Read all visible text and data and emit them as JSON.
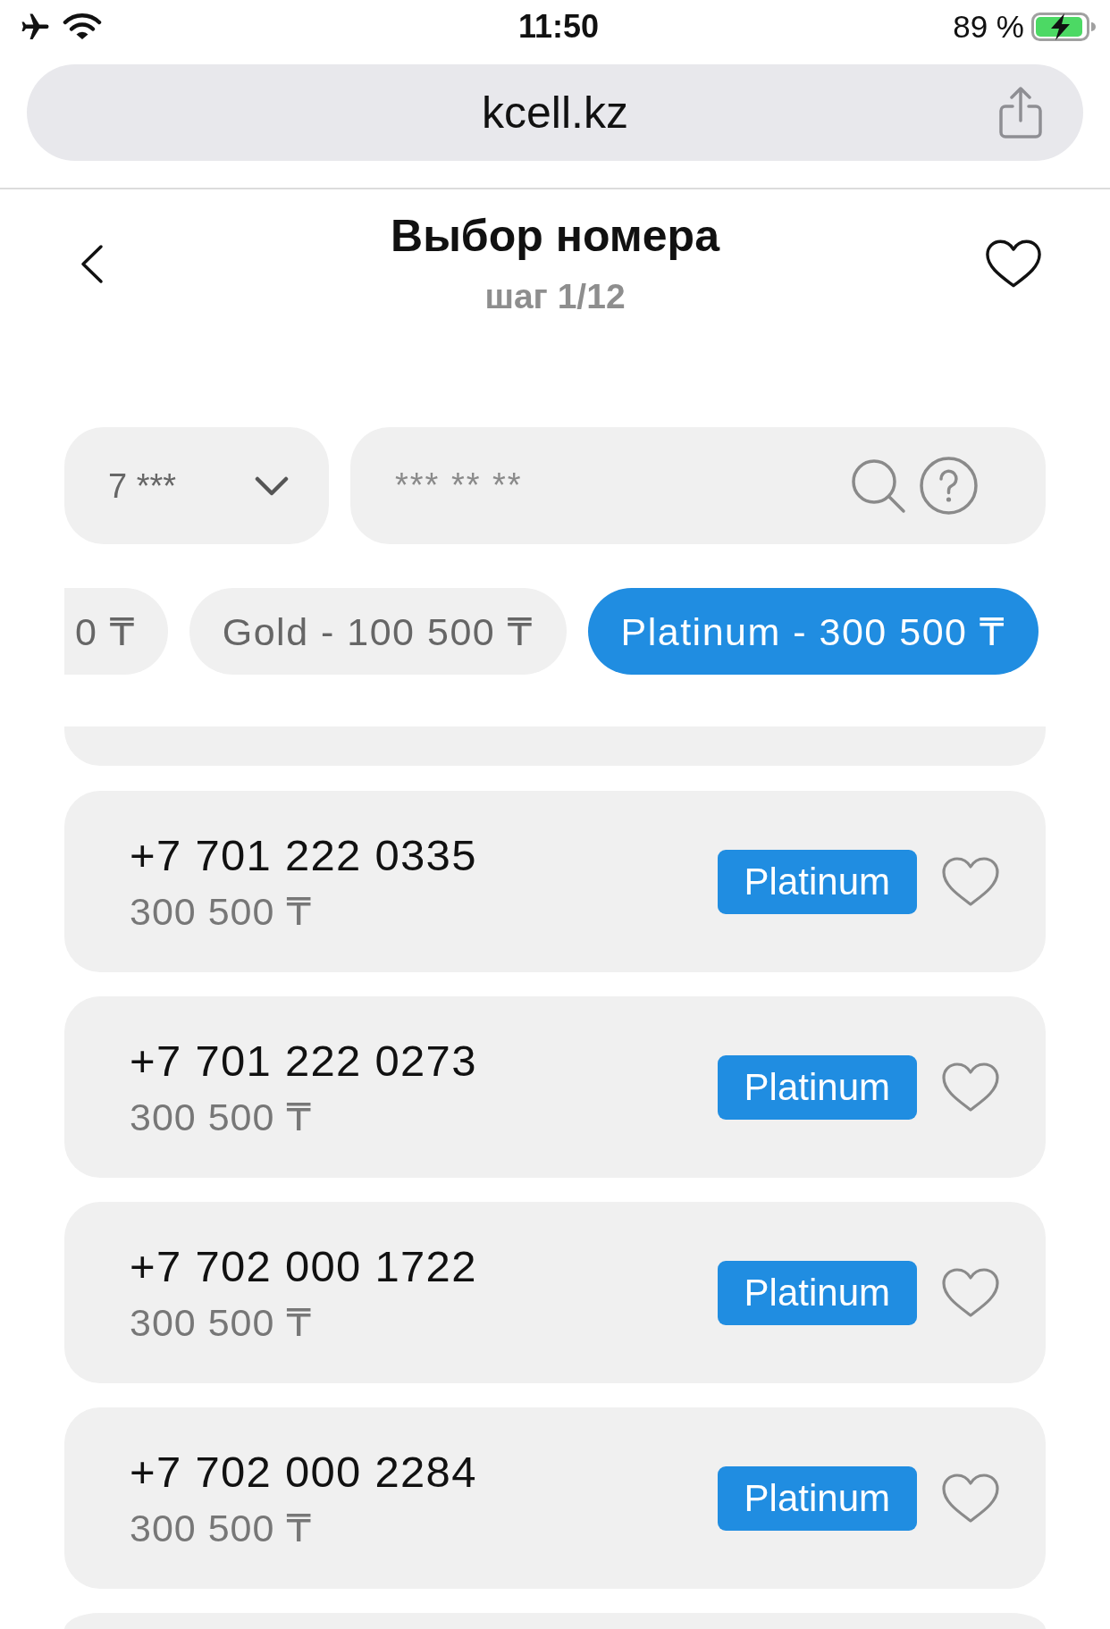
{
  "status_bar": {
    "time": "11:50",
    "battery": "89 %"
  },
  "address_bar": {
    "url": "kcell.kz"
  },
  "header": {
    "title": "Выбор номера",
    "step": "шаг 1/12"
  },
  "filters": {
    "prefix": {
      "value": "7 ***"
    },
    "number_search": {
      "placeholder": "*** ** **"
    }
  },
  "categories": [
    {
      "label": "0 ₸",
      "selected": false
    },
    {
      "label": "Gold - 100 500 ₸",
      "selected": false
    },
    {
      "label": "Platinum - 300 500 ₸",
      "selected": true
    }
  ],
  "numbers": [
    {
      "number": "+7 701 222 0335",
      "price": "300 500 ₸",
      "tier": "Platinum",
      "favorite": false
    },
    {
      "number": "+7 701 222 0273",
      "price": "300 500 ₸",
      "tier": "Platinum",
      "favorite": false
    },
    {
      "number": "+7 702 000 1722",
      "price": "300 500 ₸",
      "tier": "Platinum",
      "favorite": false
    },
    {
      "number": "+7 702 000 2284",
      "price": "300 500 ₸",
      "tier": "Platinum",
      "favorite": false
    }
  ]
}
